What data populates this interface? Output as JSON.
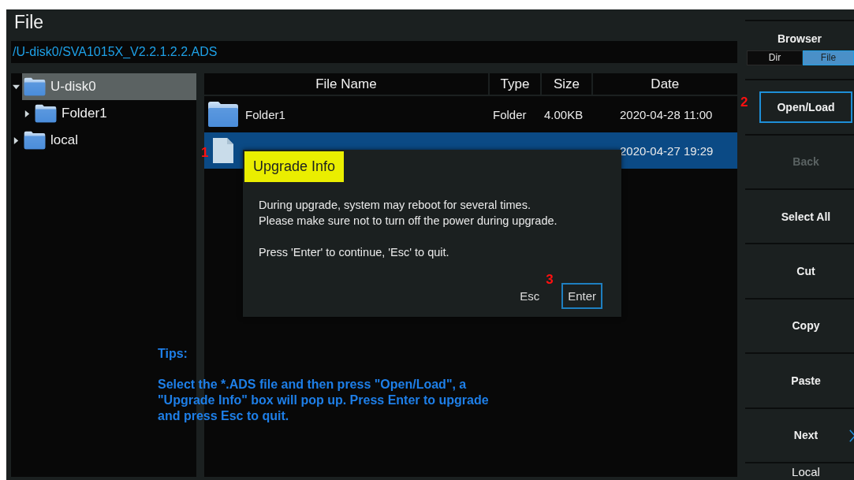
{
  "window": {
    "title": "File"
  },
  "path": "/U-disk0/SVA1015X_V2.2.1.2.2.ADS",
  "tree": [
    {
      "label": "U-disk0",
      "selected": true,
      "expanded": true,
      "children": [
        {
          "label": "Folder1",
          "selected": false,
          "expanded": false
        }
      ]
    },
    {
      "label": "local",
      "selected": false,
      "expanded": false
    }
  ],
  "table": {
    "columns": [
      "File Name",
      "Type",
      "Size",
      "Date"
    ],
    "rows": [
      {
        "kind": "folder",
        "selected": false,
        "name": "Folder1",
        "type": "Folder",
        "size": "4.00KB",
        "date": "2020-04-28 11:00"
      },
      {
        "kind": "file",
        "selected": true,
        "step": "1",
        "date": "2020-04-27 19:29"
      }
    ]
  },
  "sidebar": {
    "browser": {
      "title": "Browser",
      "options": [
        {
          "label": "Dir",
          "selected": false
        },
        {
          "label": "File",
          "selected": true
        }
      ]
    },
    "buttons": [
      {
        "label": "Open/Load",
        "focused": true,
        "disabled": false,
        "step": "2"
      },
      {
        "label": "Back",
        "focused": false,
        "disabled": true
      },
      {
        "label": "Select All",
        "focused": false,
        "disabled": false
      },
      {
        "label": "Cut",
        "focused": false,
        "disabled": false
      },
      {
        "label": "Copy",
        "focused": false,
        "disabled": false
      },
      {
        "label": "Paste",
        "focused": false,
        "disabled": false
      },
      {
        "label": "Next",
        "focused": false,
        "disabled": false,
        "more": true
      },
      {
        "label": "Local"
      }
    ]
  },
  "dialog": {
    "title": "Upgrade Info",
    "paragraphs": [
      [
        "During upgrade, system may reboot for several times.",
        "Please make sure not to turn off the power during upgrade."
      ],
      [
        "Press 'Enter' to continue, 'Esc' to quit."
      ]
    ],
    "buttons": [
      {
        "label": "Esc",
        "focused": false
      },
      {
        "label": "Enter",
        "focused": true,
        "step": "3"
      }
    ]
  },
  "tips": {
    "title": "Tips:",
    "lines": [
      "Select the *.ADS file and then press \"Open/Load\", a",
      "\"Upgrade Info\" box will pop up. Press Enter to upgrade",
      "and press Esc to quit."
    ]
  }
}
